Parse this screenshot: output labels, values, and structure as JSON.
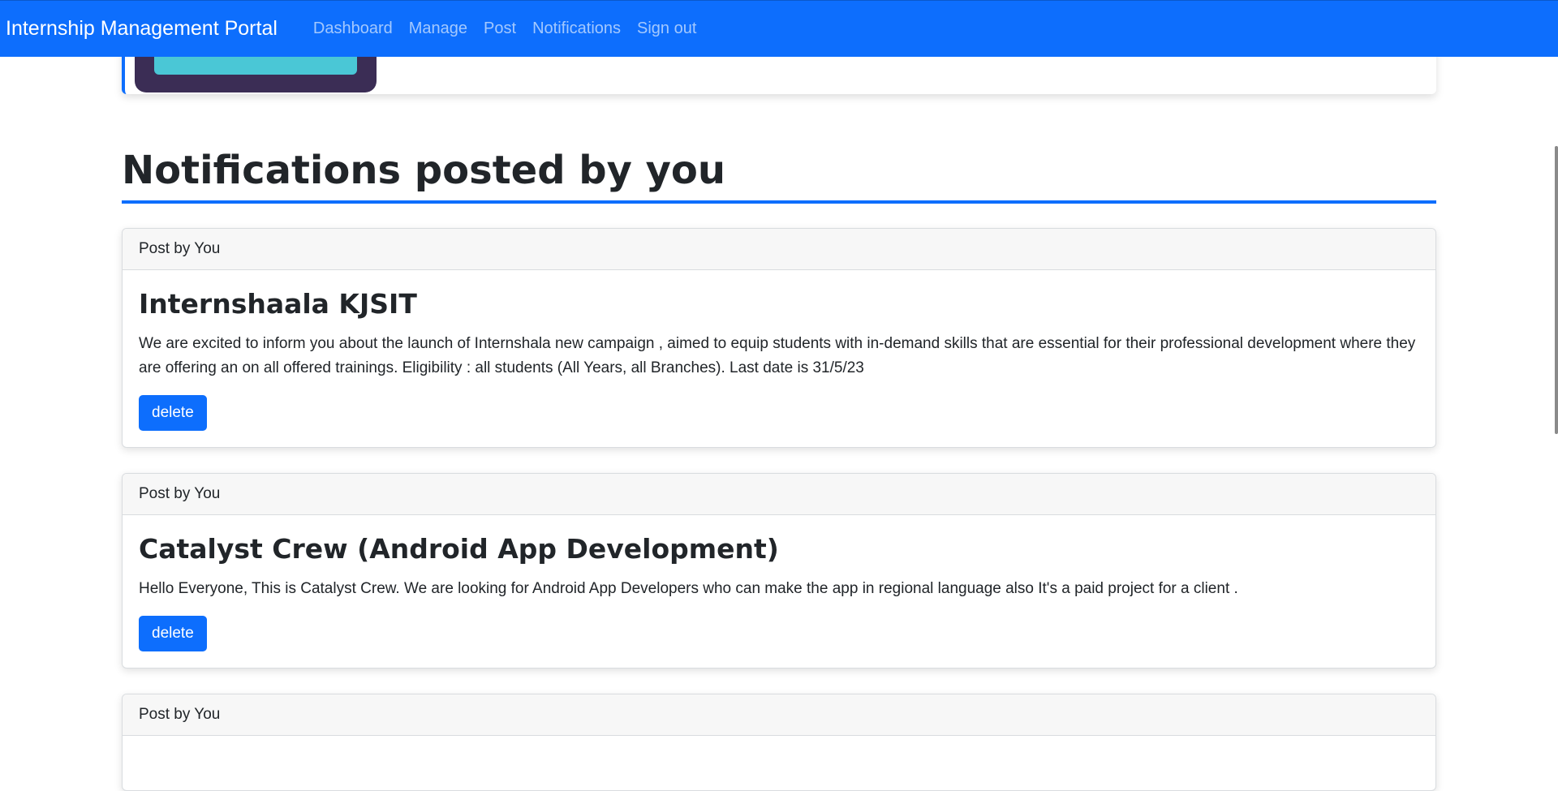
{
  "navbar": {
    "brand": "Internship Management Portal",
    "links": [
      "Dashboard",
      "Manage",
      "Post",
      "Notifications",
      "Sign out"
    ]
  },
  "section": {
    "title": "Notifications posted by you"
  },
  "posts": [
    {
      "header": "Post by You",
      "title": "Internshaala KJSIT",
      "text": "We are excited to inform you about the launch of Internshala new campaign , aimed to equip students with in-demand skills that are essential for their professional development where they are offering an on all offered trainings. Eligibility : all students (All Years, all Branches). Last date is 31/5/23",
      "button": "delete"
    },
    {
      "header": "Post by You",
      "title": "Catalyst Crew (Android App Development)",
      "text": "Hello Everyone, This is Catalyst Crew. We are looking for Android App Developers who can make the app in regional language also It's a paid project for a client .",
      "button": "delete"
    },
    {
      "header": "Post by You"
    }
  ],
  "colors": {
    "primary": "#0d6efd",
    "illustration_frame": "#3b2d55",
    "illustration_screen": "#4ac7d6"
  }
}
